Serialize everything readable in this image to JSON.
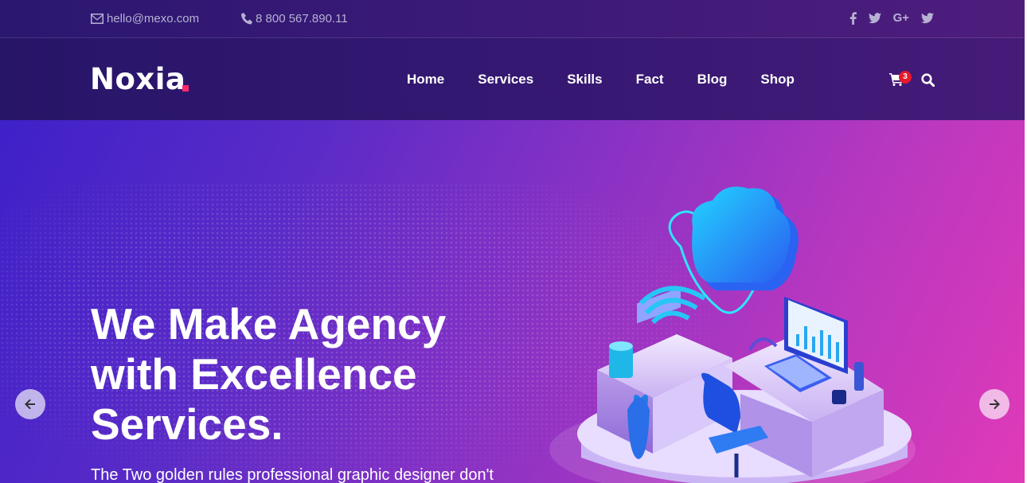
{
  "topbar": {
    "email": "hello@mexo.com",
    "phone": "8 800 567.890.11",
    "social_icons": [
      "facebook-icon",
      "twitter-icon",
      "google-plus-icon",
      "twitter-icon"
    ],
    "google_plus_label": "G+"
  },
  "brand": {
    "name": "Noxia",
    "accent_color": "#ff2a6d"
  },
  "nav": {
    "items": [
      {
        "label": "Home"
      },
      {
        "label": "Services"
      },
      {
        "label": "Skills"
      },
      {
        "label": "Fact"
      },
      {
        "label": "Blog"
      },
      {
        "label": "Shop"
      }
    ],
    "cart_count": "3"
  },
  "hero": {
    "headline_line1": "We Make Agency",
    "headline_line2": "with Excellence",
    "headline_line3": "Services.",
    "subtext": "The Two golden rules professional graphic designer don't",
    "gradient_colors": [
      "#3a1fc9",
      "#8a32c4",
      "#e03ab8"
    ]
  }
}
